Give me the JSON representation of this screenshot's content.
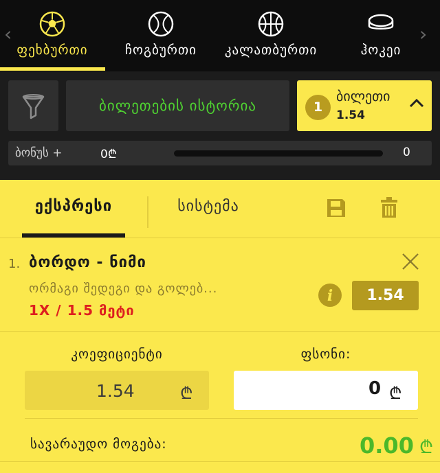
{
  "sports": {
    "items": [
      {
        "label": "ფეხბურთი",
        "icon": "soccer-ball-icon",
        "active": true
      },
      {
        "label": "ჩოგბურთი",
        "icon": "tennis-ball-icon",
        "active": false
      },
      {
        "label": "კალათბურთი",
        "icon": "basketball-icon",
        "active": false
      },
      {
        "label": "ჰოკეი",
        "icon": "hockey-puck-icon",
        "active": false
      }
    ],
    "prev_arrow": "‹",
    "next_arrow": "›"
  },
  "toolbar": {
    "history_label": "ბილეთების ისტორია",
    "ticket": {
      "count": "1",
      "label": "ბილეთი",
      "odds": "1.54"
    }
  },
  "bonus": {
    "label": "ბონუს +",
    "value": "0₾",
    "count": "0"
  },
  "tabs": {
    "express": "ექსპრესი",
    "system": "სისტემა"
  },
  "bet": {
    "number": "1.",
    "match": "ბორდო - ნიმი",
    "market": "ორმაგი შედეგი და გოლებ...",
    "pick": "1X / 1.5 მეტი",
    "odds": "1.54"
  },
  "stake": {
    "coef_label": "კოეფიციენტი",
    "coef_value": "1.54",
    "stake_label": "ფსონი:",
    "stake_value": "0",
    "currency": "₾"
  },
  "win": {
    "label": "სავარაუდო მოგება:",
    "value": "0.00",
    "currency": "₾"
  },
  "colors": {
    "accent": "#fbe84d",
    "green": "#4fd331",
    "red": "#dd1f1f",
    "dark": "#0d0d0d"
  }
}
